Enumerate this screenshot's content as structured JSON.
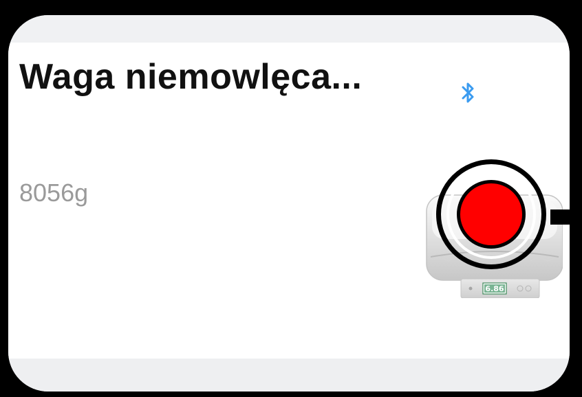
{
  "device": {
    "name": "Waga niemowlęca...",
    "weight": "8056g",
    "connection_icon": "bluetooth-icon",
    "thumbnail_icon": "baby-scale-icon",
    "display_reading": "6.86"
  },
  "highlight": {
    "marker": "red-dot-marker",
    "color": "#ff0000"
  },
  "colors": {
    "bluetooth": "#3a9bf0",
    "card_background": "#ffffff",
    "page_background": "#f0f1f3",
    "weight_text": "#9a9a9a"
  }
}
